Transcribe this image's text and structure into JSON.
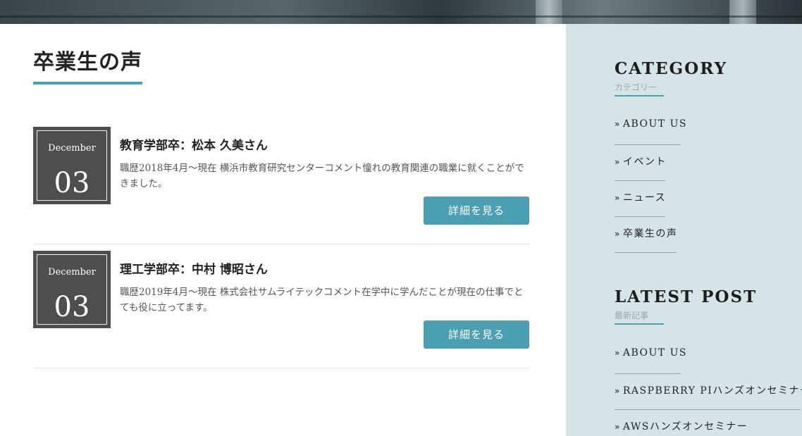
{
  "main": {
    "page_title": "卒業生の声",
    "posts": [
      {
        "month": "December",
        "day": "03",
        "title": "教育学部卒：松本 久美さん",
        "excerpt": "職歴2018年4月～現在 横浜市教育研究センターコメント憧れの教育関連の職業に就くことができました。",
        "button": "詳細を見る"
      },
      {
        "month": "December",
        "day": "03",
        "title": "理工学部卒：中村 博昭さん",
        "excerpt": "職歴2019年4月～現在 株式会社サムライテックコメント在学中に学んだことが現在の仕事でとても役に立ってます。",
        "button": "詳細を見る"
      }
    ]
  },
  "sidebar": {
    "category": {
      "title": "CATEGORY",
      "subtitle": "カテゴリー",
      "items": [
        "ABOUT US",
        "イベント",
        "ニュース",
        "卒業生の声"
      ]
    },
    "latest": {
      "title": "LATEST POST",
      "subtitle": "最新記事",
      "items": [
        "ABOUT US",
        "RASPBERRY PIハンズオンセミナー",
        "AWSハンズオンセミナー"
      ]
    },
    "chevron_icon": "double-chevron-right-icon"
  },
  "colors": {
    "accent": "#4b9fb2",
    "date_box": "#4e4e4e",
    "sidebar_bg": "#d4e4e7"
  }
}
